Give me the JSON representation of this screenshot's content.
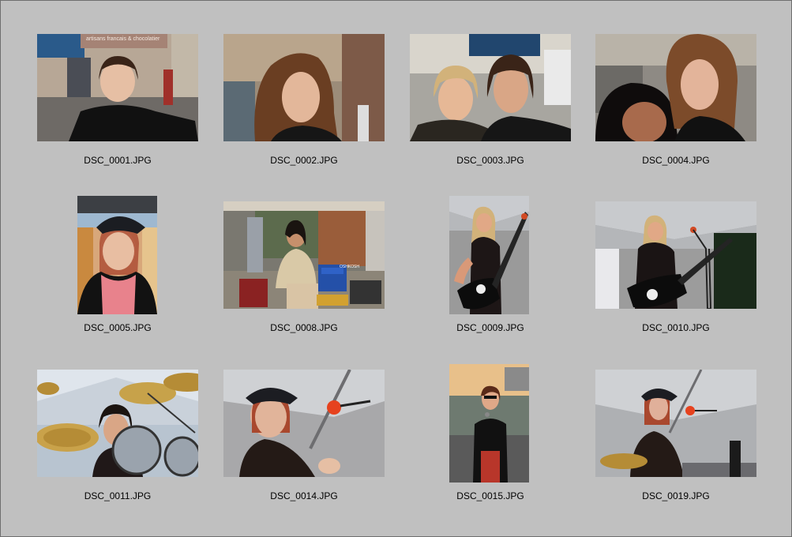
{
  "gallery": {
    "items": [
      {
        "filename": "DSC_0001.JPG",
        "sign_text": "artisans francais & chocolatier"
      },
      {
        "filename": "DSC_0002.JPG"
      },
      {
        "filename": "DSC_0003.JPG"
      },
      {
        "filename": "DSC_0004.JPG"
      },
      {
        "filename": "DSC_0005.JPG"
      },
      {
        "filename": "DSC_0008.JPG",
        "chair_text": "OSHKOSH"
      },
      {
        "filename": "DSC_0009.JPG"
      },
      {
        "filename": "DSC_0010.JPG"
      },
      {
        "filename": "DSC_0011.JPG"
      },
      {
        "filename": "DSC_0014.JPG"
      },
      {
        "filename": "DSC_0015.JPG"
      },
      {
        "filename": "DSC_0019.JPG"
      }
    ]
  },
  "colors": {
    "background": "#c0c0c0",
    "border": "#6e6e6e",
    "caption": "#000000"
  }
}
